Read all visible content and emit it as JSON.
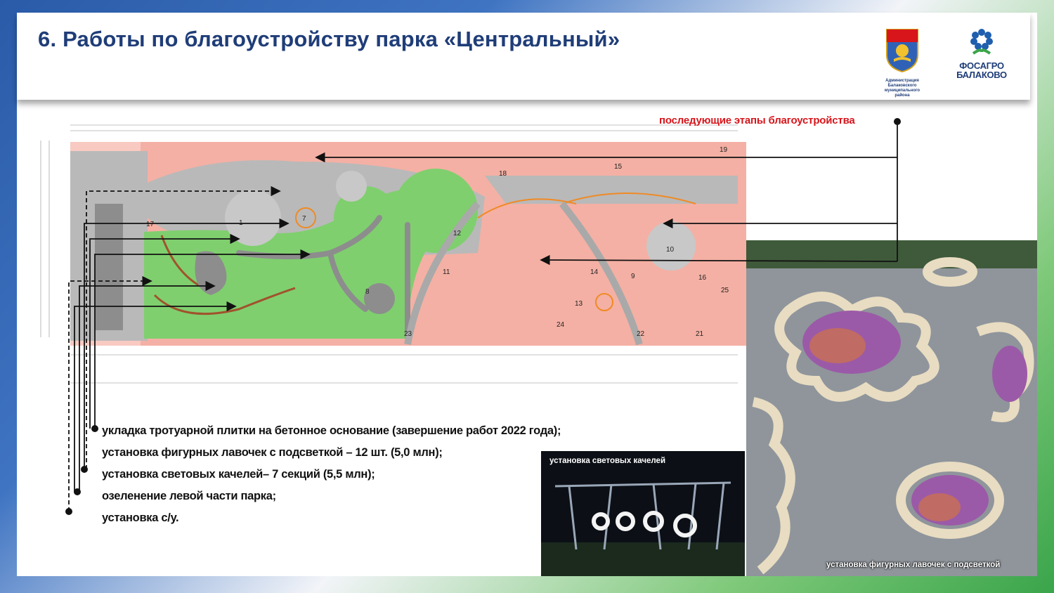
{
  "header": {
    "title": "6. Работы по благоустройству парка «Центральный»",
    "admin_logo_caption": [
      "Администрация",
      "Балаковского муниципального",
      "района"
    ],
    "partner_logo_line1": "ФОСАГРО",
    "partner_logo_line2": "БАЛАКОВО"
  },
  "plan": {
    "next_stages_label": "последующие этапы благоустройства",
    "zone_numbers": [
      "1",
      "7",
      "8",
      "9",
      "10",
      "11",
      "12",
      "13",
      "14",
      "15",
      "16",
      "17",
      "18",
      "19",
      "21",
      "22",
      "23",
      "24",
      "25"
    ],
    "colors": {
      "next_stages": "#f3a79a",
      "greening": "#7fcf6e",
      "paving": "#b9b9b9",
      "label_red": "#d7151b",
      "title_blue": "#1f3d78"
    }
  },
  "photos": {
    "plaza_caption": "установка фигурных лавочек с подсветкой",
    "swings_caption": "установка световых качелей"
  },
  "works": [
    "укладка тротуарной плитки на бетонное основание (завершение работ 2022 года);",
    "установка фигурных лавочек с подсветкой – 12 шт. (5,0 млн);",
    "установка световых качелей– 7 секций (5,5 млн);",
    "озеленение левой части парка;",
    "установка с/у."
  ]
}
